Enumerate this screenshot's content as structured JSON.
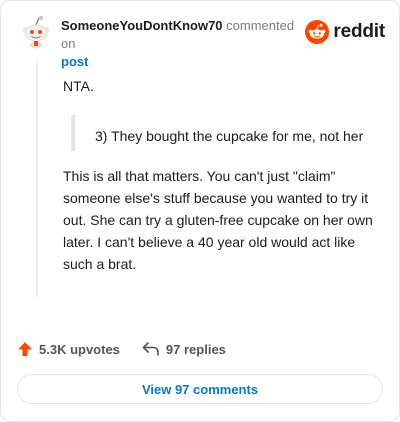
{
  "header": {
    "username": "SomeoneYouDontKnow70",
    "action_text": "commented on",
    "post_link": "post"
  },
  "logo": {
    "text": "reddit",
    "icon": "reddit-snoo-icon",
    "accent": "#ff4500"
  },
  "comment": {
    "line1": "NTA.",
    "quote": "3) They bought the cupcake for me, not her",
    "body": "This is all that matters. You can't just \"claim\" someone else's stuff because you wanted to try it out. She can try a gluten-free cupcake on her own later. I can't believe a 40 year old would act like such a brat."
  },
  "actions": {
    "upvotes": "5.3K upvotes",
    "upvote_icon": "upvote-arrow-icon",
    "replies": "97 replies",
    "reply_icon": "reply-arrow-icon"
  },
  "view_comments": "View 97 comments"
}
